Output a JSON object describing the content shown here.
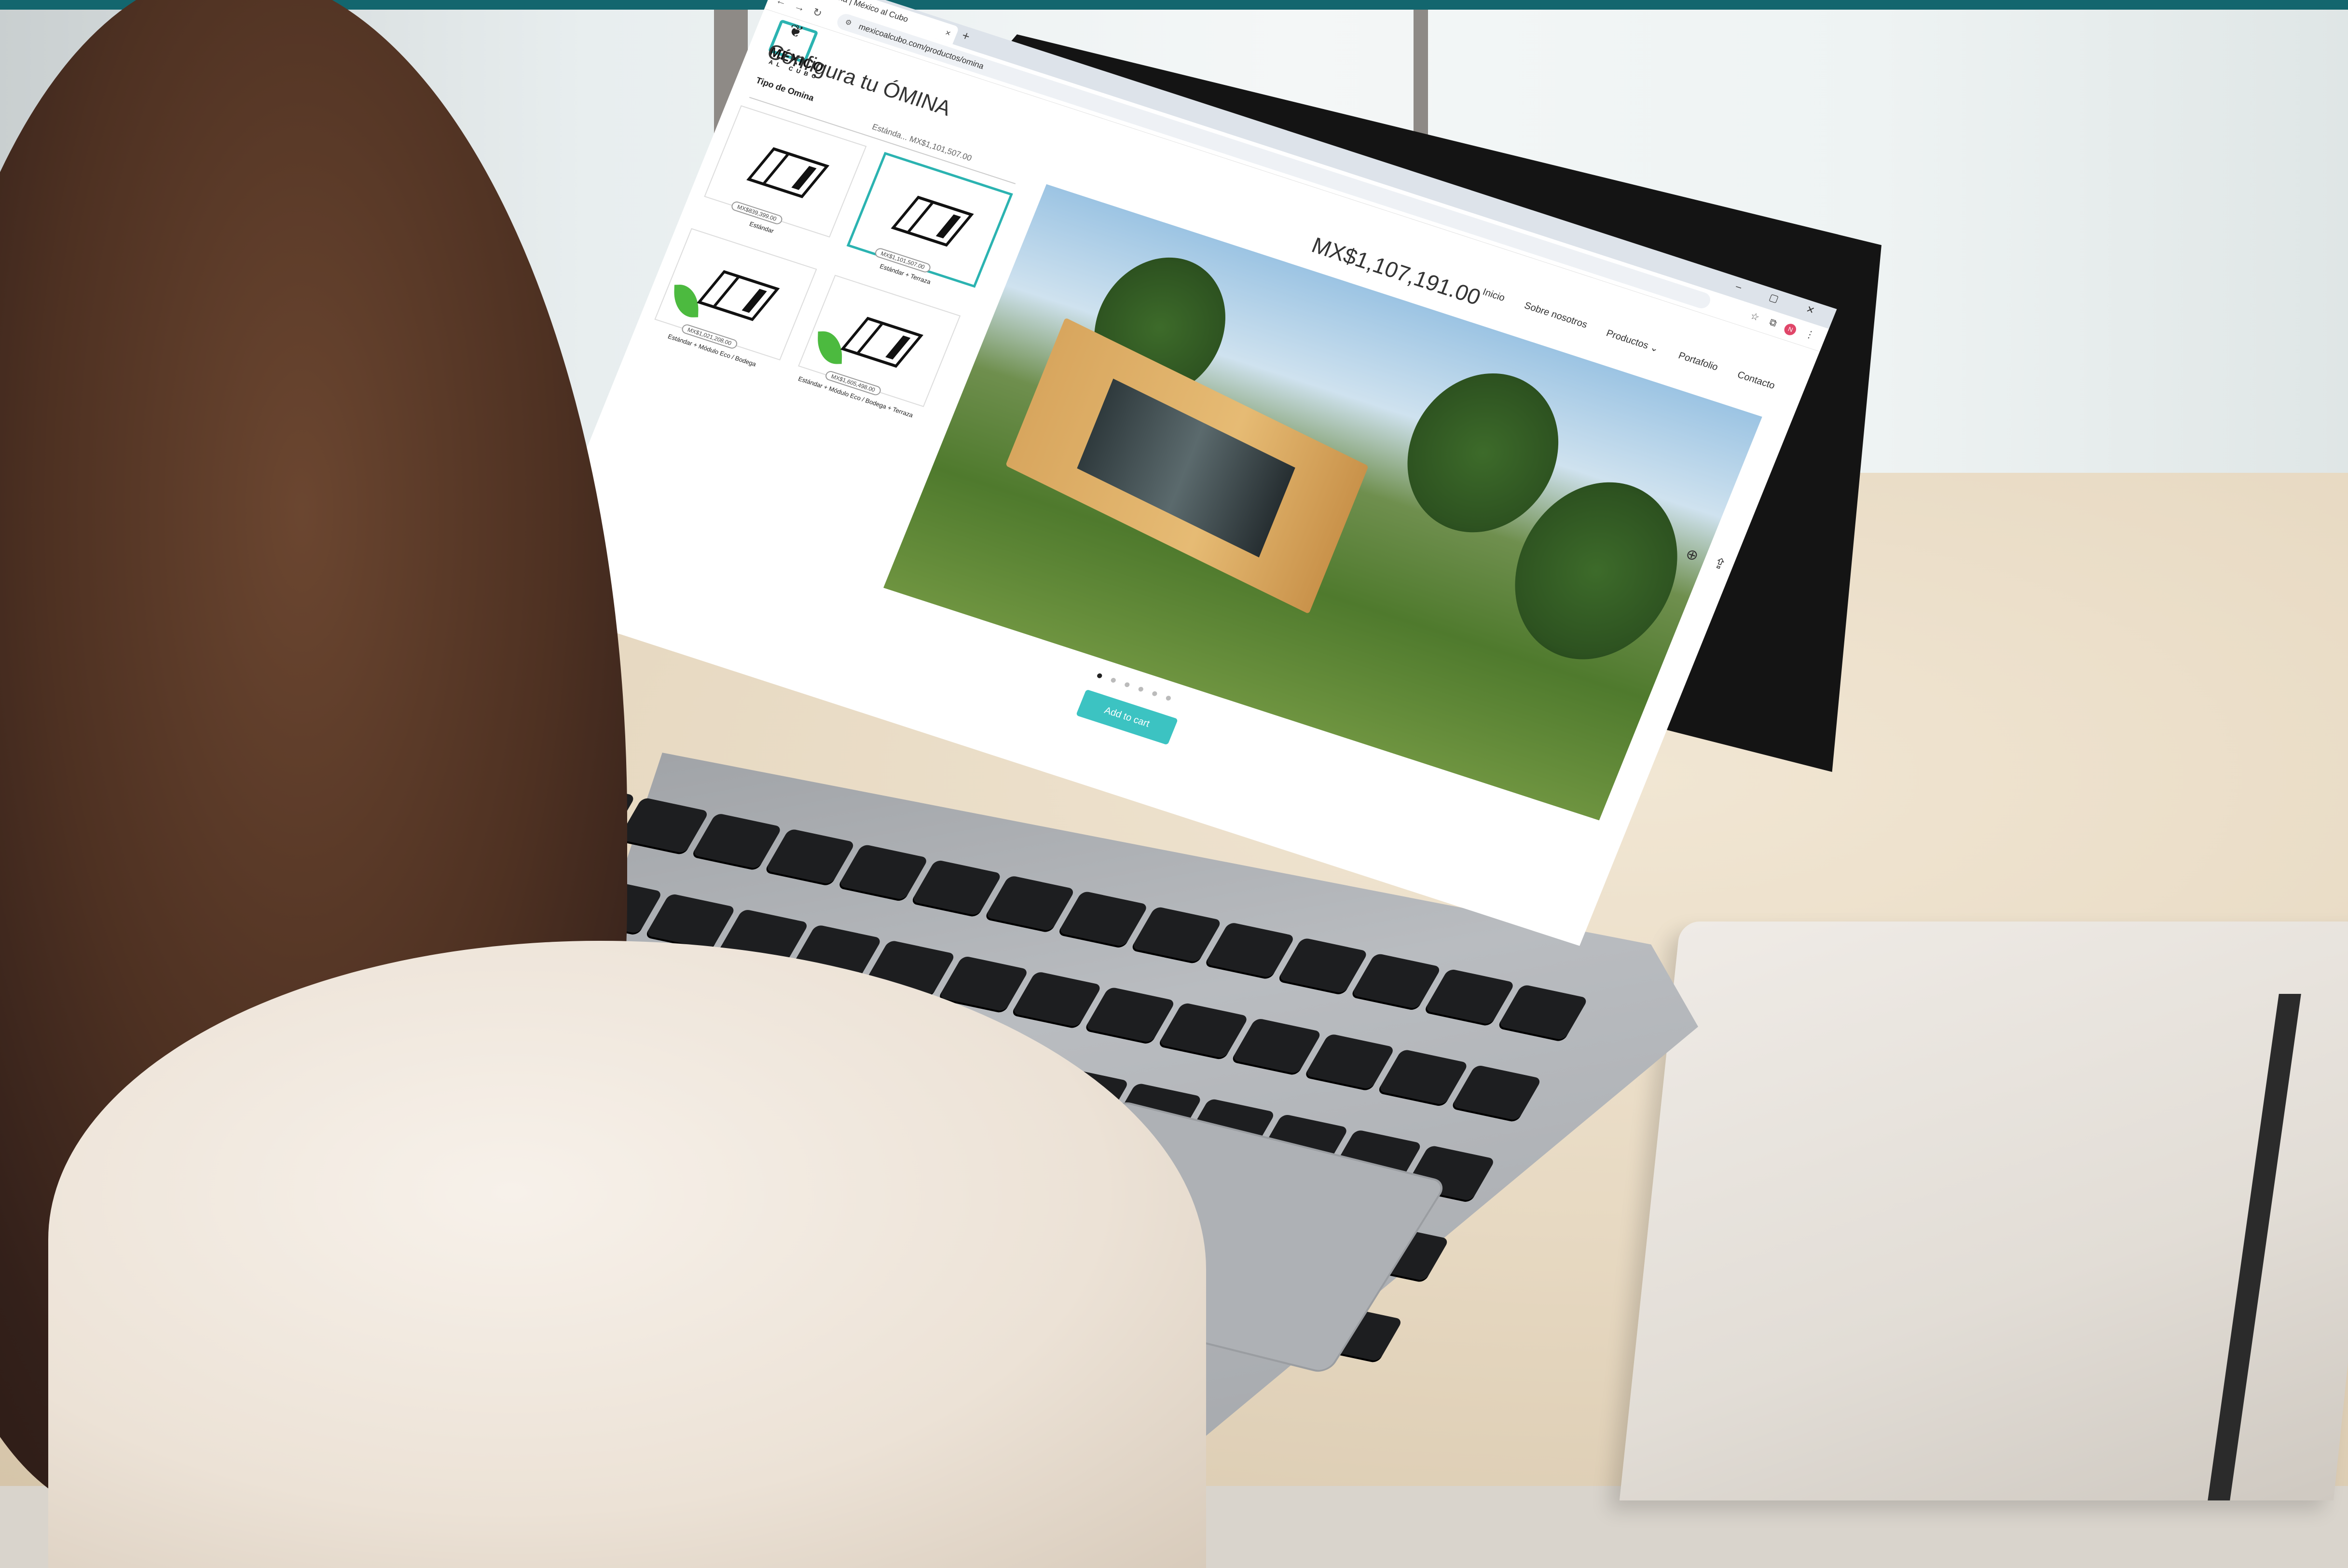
{
  "browser": {
    "tab_title": "Ómina | México al Cubo",
    "tab_close": "×",
    "new_tab": "+",
    "tab_list": "⌄",
    "url": "mexicoalcubo.com/productos/omina",
    "window_controls": "– ▢ ✕",
    "profile_initial": "N"
  },
  "site": {
    "logo_text": "MÉXICO",
    "logo_subtext": "AL CUBO",
    "nav": [
      "Inicio",
      "Sobre nosotros",
      "Productos ⌄",
      "Portafolio",
      "Contacto"
    ]
  },
  "product": {
    "page_title": "Configura tu ÓMINA",
    "option_label": "Tipo de Omina",
    "selected_summary": "Estánda... MX$1,101,507.00",
    "price": "MX$1,107,191.00",
    "cart_button": "Add to cart",
    "options": [
      {
        "price": "MX$839,399.00",
        "name": "Estándar",
        "selected": false,
        "eco": false
      },
      {
        "price": "MX$1,101,507.00",
        "name": "Estándar + Terraza",
        "selected": true,
        "eco": false
      },
      {
        "price": "MX$1,021,208.00",
        "name": "Estándar + Módulo Eco / Bodega",
        "selected": false,
        "eco": true
      },
      {
        "price": "MX$1,605,498.00",
        "name": "Estándar + Módulo Eco / Bodega + Terraza",
        "selected": false,
        "eco": true
      }
    ],
    "carousel_dots": 6,
    "active_dot": 0
  },
  "colors": {
    "brand_teal": "#2bb3b1",
    "cart_button": "#3cc3c2",
    "top_band": "#13666e",
    "eco_leaf": "#4cba3f"
  }
}
